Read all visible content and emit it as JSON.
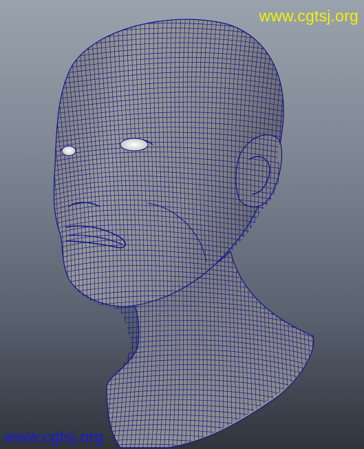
{
  "viewport": {
    "background_top": "#9aa3ad",
    "background_bottom": "#2f343c",
    "mesh_fill": "#8c8d8b",
    "mesh_shadow": "#4f5153",
    "wire_color": "#10138a",
    "eye_color": "#e8e8e0"
  },
  "watermarks": {
    "top": "www.cgtsj.org",
    "bottom": "www.cgtsj.org",
    "top_color": "#f2f200",
    "bottom_color": "#1a1ad8"
  }
}
